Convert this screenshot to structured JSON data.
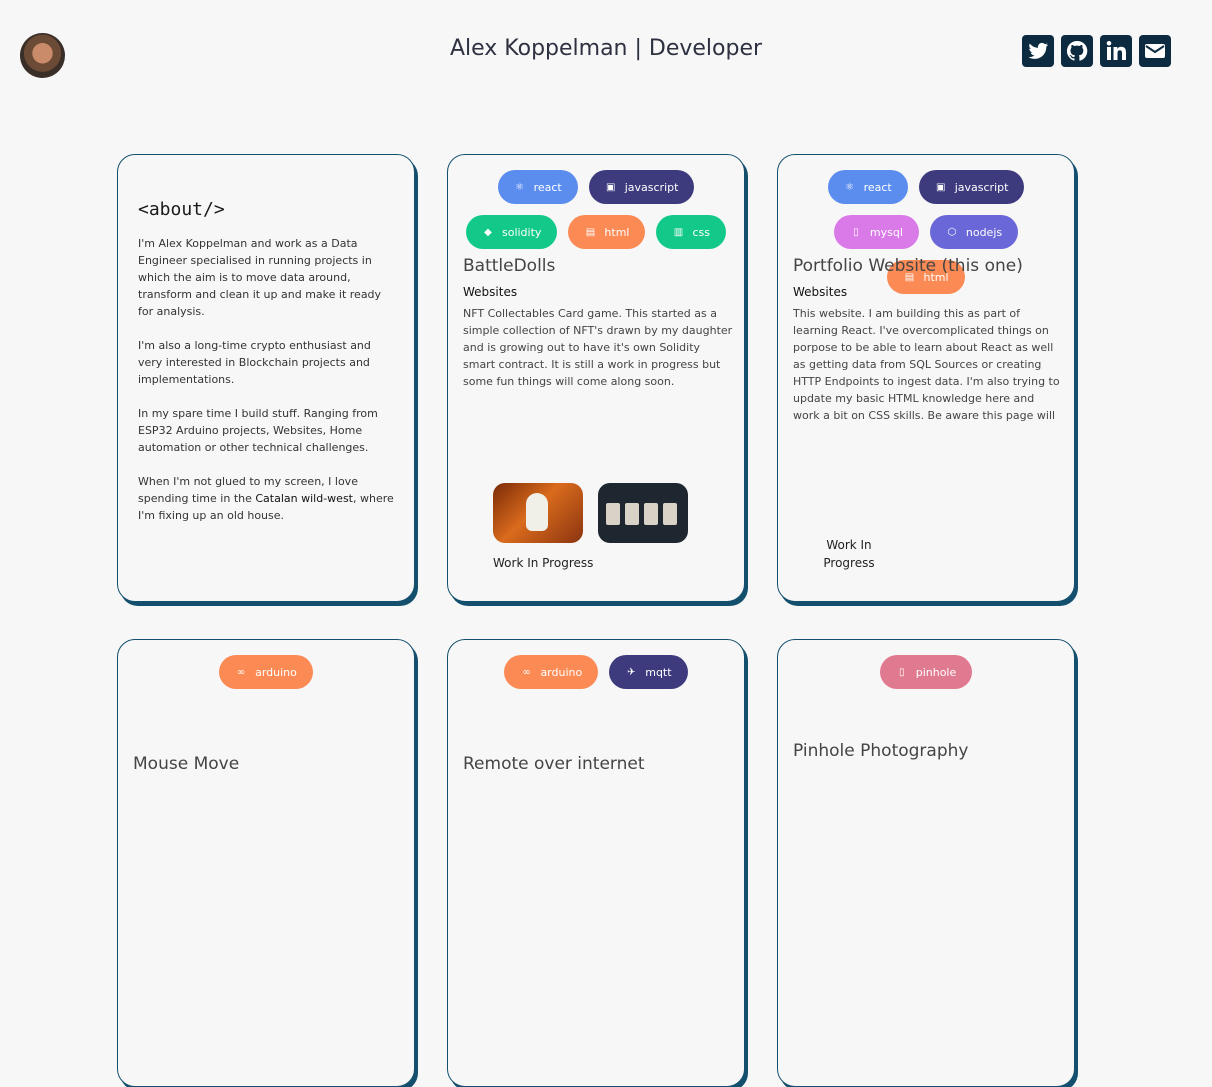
{
  "header": {
    "title": "Alex Koppelman | Developer",
    "socials": [
      "twitter-icon",
      "github-icon",
      "linkedin-icon",
      "email-icon"
    ]
  },
  "about": {
    "title": "<about/>",
    "paragraphs": [
      "I'm Alex Koppelman and work as a Data Engineer specialised in running projects in which the aim is to move data around, transform and clean it up and make it ready for analysis.",
      "I'm also a long-time crypto enthusiast and very interested in Blockchain projects and implementations.",
      "In my spare time I build stuff. Ranging from ESP32 Arduino projects, Websites, Home automation or other technical challenges.",
      "When I'm not glued to my screen, I love spending time in the",
      "Catalan wild-west",
      ", where I'm fixing up an old house."
    ]
  },
  "projects": [
    {
      "badges": [
        {
          "label": "react",
          "color": "#5b8def",
          "icon": "⚛"
        },
        {
          "label": "javascript",
          "color": "#3d3b7e",
          "icon": "▣"
        },
        {
          "label": "solidity",
          "color": "#12c98a",
          "icon": "◆"
        },
        {
          "label": "html",
          "color": "#fb8a55",
          "icon": "▤"
        },
        {
          "label": "css",
          "color": "#12c98a",
          "icon": "▥"
        }
      ],
      "title": "BattleDolls",
      "category": "Websites",
      "description": "NFT Collectables Card game. This started as a simple collection of NFT's drawn by my daughter and is growing out to have it's own Solidity smart contract. It is still a work in progress but some fun things will come along soon.",
      "status": "Work In Progress"
    },
    {
      "badges": [
        {
          "label": "react",
          "color": "#5b8def",
          "icon": "⚛"
        },
        {
          "label": "javascript",
          "color": "#3d3b7e",
          "icon": "▣"
        },
        {
          "label": "mysql",
          "color": "#d97ae8",
          "icon": "▯"
        },
        {
          "label": "nodejs",
          "color": "#6a67d8",
          "icon": "⬡"
        },
        {
          "label": "html",
          "color": "#fb8a55",
          "icon": "▤"
        }
      ],
      "title": "Portfolio Website (this one)",
      "category": "Websites",
      "description": "This website. I am building this as part of learning React. I've overcomplicated things on porpose to be able to learn about React as well as getting data from SQL Sources or creating HTTP Endpoints to ingest data. I'm also trying to update my basic HTML knowledge here and work a bit on CSS skills. Be aware this page will have ongoing",
      "status": "Work In Progress"
    },
    {
      "badges": [
        {
          "label": "arduino",
          "color": "#fb8a55",
          "icon": "∞"
        }
      ],
      "title": "Mouse Move"
    },
    {
      "badges": [
        {
          "label": "arduino",
          "color": "#fb8a55",
          "icon": "∞"
        },
        {
          "label": "mqtt",
          "color": "#3d3b7e",
          "icon": "✈"
        }
      ],
      "title": "Remote over internet"
    },
    {
      "badges": [
        {
          "label": "pinhole",
          "color": "#e07a90",
          "icon": "▯"
        }
      ],
      "title": "Pinhole Photography"
    }
  ]
}
